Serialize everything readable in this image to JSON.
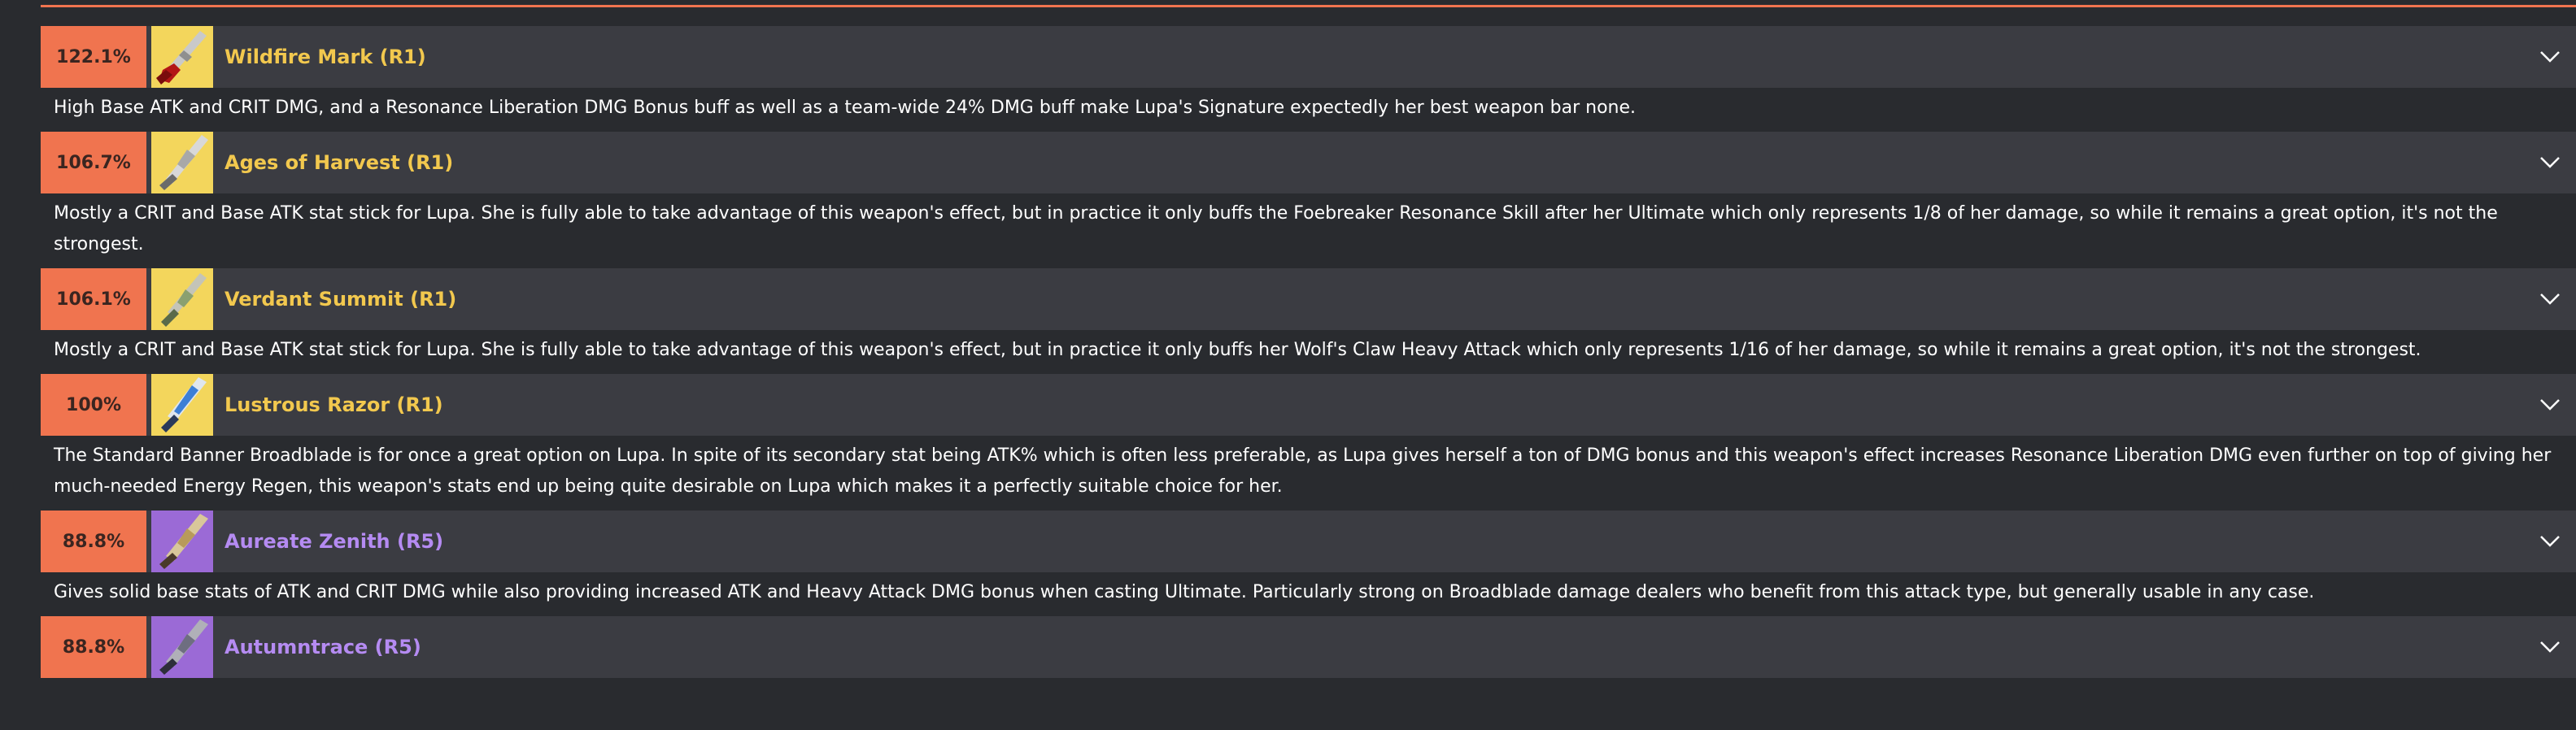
{
  "colors": {
    "accent": "#f0744f",
    "rank_gold": "#f2c84e",
    "rank_purple": "#b58bf2",
    "row_bg": "#3b3c42",
    "page_bg": "#292b2f"
  },
  "weapons": [
    {
      "percent": "122.1%",
      "name": "Wildfire Mark (R1)",
      "rarity": "gold",
      "icon": "broadblade-red-icon",
      "description": "High Base ATK and CRIT DMG, and a Resonance Liberation DMG Bonus buff as well as a team-wide 24% DMG buff make Lupa's Signature expectedly her best weapon bar none."
    },
    {
      "percent": "106.7%",
      "name": "Ages of Harvest (R1)",
      "rarity": "gold",
      "icon": "broadblade-silver-icon",
      "description": "Mostly a CRIT and Base ATK stat stick for Lupa. She is fully able to take advantage of this weapon's effect, but in practice it only buffs the Foebreaker Resonance Skill after her Ultimate which only represents 1/8 of her damage, so while it remains a great option, it's not the strongest."
    },
    {
      "percent": "106.1%",
      "name": "Verdant Summit (R1)",
      "rarity": "gold",
      "icon": "broadblade-green-icon",
      "description": "Mostly a CRIT and Base ATK stat stick for Lupa. She is fully able to take advantage of this weapon's effect, but in practice it only buffs her Wolf's Claw Heavy Attack which only represents 1/16 of her damage, so while it remains a great option, it's not the strongest."
    },
    {
      "percent": "100%",
      "name": "Lustrous Razor (R1)",
      "rarity": "gold",
      "icon": "broadblade-blue-icon",
      "description": "The Standard Banner Broadblade is for once a great option on Lupa. In spite of its secondary stat being ATK% which is often less preferable, as Lupa gives herself a ton of DMG bonus and this weapon's effect increases Resonance Liberation DMG even further on top of giving her much-needed Energy Regen, this weapon's stats end up being quite desirable on Lupa which makes it a perfectly suitable choice for her."
    },
    {
      "percent": "88.8%",
      "name": "Aureate Zenith (R5)",
      "rarity": "purple",
      "icon": "broadblade-gold-icon",
      "description": "Gives solid base stats of ATK and CRIT DMG while also providing increased ATK and Heavy Attack DMG bonus when casting Ultimate. Particularly strong on Broadblade damage dealers who benefit from this attack type, but generally usable in any case."
    },
    {
      "percent": "88.8%",
      "name": "Autumntrace (R5)",
      "rarity": "purple",
      "icon": "broadblade-dark-icon",
      "description": ""
    }
  ]
}
